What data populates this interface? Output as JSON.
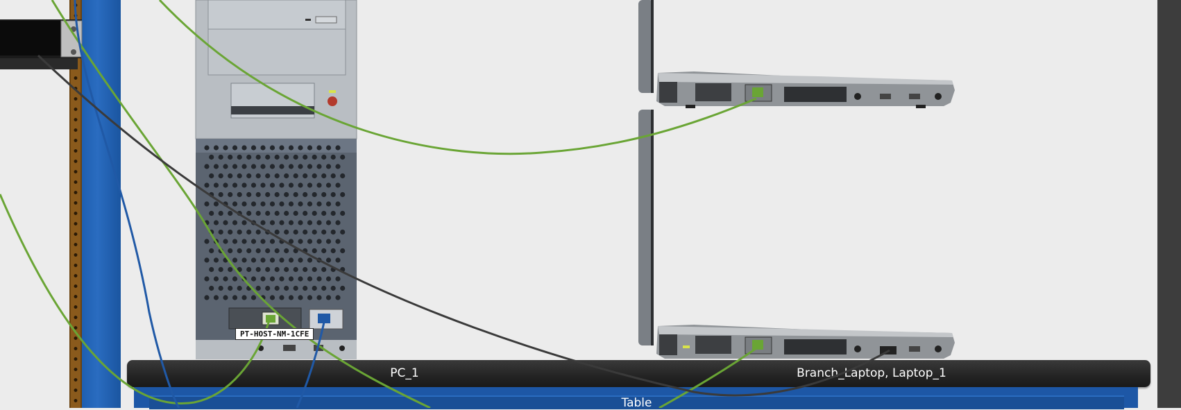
{
  "devices": {
    "pc_label": "PC_1",
    "laptops_label": "Branch_Laptop, Laptop_1",
    "table_label": "Table",
    "module_tooltip": "PT-HOST-NM-1CFE"
  },
  "icons": {
    "pc": "desktop-tower-icon",
    "laptop": "laptop-side-icon",
    "rack_device": "rack-switch-icon",
    "ethernet_port": "ethernet-port-icon"
  },
  "colors": {
    "background": "#ececec",
    "copper_cable": "#6aa535",
    "serial_cable": "#2059a6",
    "console_cable": "#3a3a3a",
    "shelf": "#262626",
    "table": "#1d57a6"
  }
}
